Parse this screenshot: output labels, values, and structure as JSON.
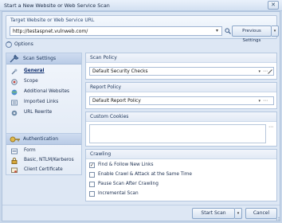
{
  "window": {
    "title": "Start a New Website or Web Service Scan",
    "close_glyph": "✕"
  },
  "target": {
    "label": "Target Website or Web Service URL",
    "url": "http://testaspnet.vulnweb.com/",
    "previous_settings_label": "Previous Settings"
  },
  "options_label": "Options",
  "nav": {
    "scan_settings": {
      "header": "Scan Settings",
      "items": [
        {
          "label": "General",
          "icon": "wrench-icon",
          "active": true
        },
        {
          "label": "Scope",
          "icon": "target-icon"
        },
        {
          "label": "Additional Websites",
          "icon": "globe-icon"
        },
        {
          "label": "Imported Links",
          "icon": "link-icon"
        },
        {
          "label": "URL Rewrite",
          "icon": "rewrite-icon"
        }
      ]
    },
    "authentication": {
      "header": "Authentication",
      "items": [
        {
          "label": "Form",
          "icon": "form-icon"
        },
        {
          "label": "Basic, NTLM/Kerberos",
          "icon": "lock-icon"
        },
        {
          "label": "Client Certificate",
          "icon": "certificate-icon"
        }
      ]
    }
  },
  "scan_policy": {
    "header": "Scan Policy",
    "value": "Default Security Checks"
  },
  "report_policy": {
    "header": "Report Policy",
    "value": "Default Report Policy"
  },
  "custom_cookies": {
    "header": "Custom Cookies"
  },
  "crawling": {
    "header": "Crawling",
    "options": [
      {
        "label": "Find & Follow New Links",
        "checked": true
      },
      {
        "label": "Enable Crawl & Attack at the Same Time",
        "checked": false
      },
      {
        "label": "Pause Scan After Crawling",
        "checked": false
      },
      {
        "label": "Incremental Scan",
        "checked": false
      }
    ]
  },
  "buttons": {
    "start": "Start Scan",
    "cancel": "Cancel"
  }
}
